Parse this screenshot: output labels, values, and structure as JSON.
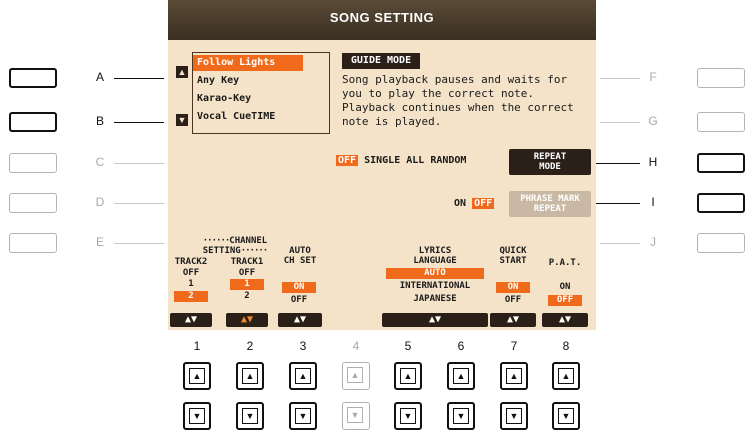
{
  "screen": {
    "title": "SONG SETTING",
    "list": {
      "items": [
        "Follow Lights",
        "Any Key",
        "Karao-Key",
        "Vocal CueTIME"
      ],
      "selected_index": 0,
      "up_icon": "triangle-up-icon",
      "down_icon": "triangle-down-icon"
    },
    "guide_mode": {
      "heading": "GUIDE MODE",
      "description": "Song playback pauses and waits for you to play the correct note. Playback continues when the correct note is played."
    },
    "repeat": {
      "off_label": "OFF",
      "options_label": "SINGLE ALL RANDOM",
      "button_label_1": "REPEAT",
      "button_label_2": "MODE"
    },
    "phrase_mark": {
      "on_label": "ON",
      "off_label": "OFF",
      "button_label_1": "PHRASE MARK",
      "button_label_2": "REPEAT"
    },
    "channel_setting": {
      "heading": "CHANNEL SETTING",
      "track2": {
        "label": "TRACK2",
        "values": [
          "OFF",
          "1",
          "2"
        ],
        "selected": "2"
      },
      "track1": {
        "label": "TRACK1",
        "values": [
          "OFF",
          "1",
          "2"
        ],
        "selected": "1"
      },
      "auto_ch_set": {
        "label_1": "AUTO",
        "label_2": "CH SET",
        "values": [
          "ON",
          "OFF"
        ],
        "selected": "ON"
      }
    },
    "lyrics_language": {
      "label_1": "LYRICS",
      "label_2": "LANGUAGE",
      "values": [
        "AUTO",
        "INTERNATIONAL",
        "JAPANESE"
      ],
      "selected": "AUTO"
    },
    "quick_start": {
      "label_1": "QUICK",
      "label_2": "START",
      "values": [
        "ON",
        "OFF"
      ],
      "selected": "ON"
    },
    "pat": {
      "label": "P.A.T.",
      "values": [
        "ON",
        "OFF"
      ],
      "selected": "OFF"
    },
    "updown_glyph": "▲▼"
  },
  "side_buttons": {
    "left": [
      "A",
      "B",
      "C",
      "D",
      "E"
    ],
    "right": [
      "F",
      "G",
      "H",
      "I",
      "J"
    ]
  },
  "bottom_buttons": {
    "numbers": [
      "1",
      "2",
      "3",
      "4",
      "5",
      "6",
      "7",
      "8"
    ],
    "up_glyph": "▲",
    "down_glyph": "▼"
  },
  "colors": {
    "lcd_background": "#f4e3c9",
    "accent_orange": "#f06a1c",
    "dark": "#2a2018"
  }
}
